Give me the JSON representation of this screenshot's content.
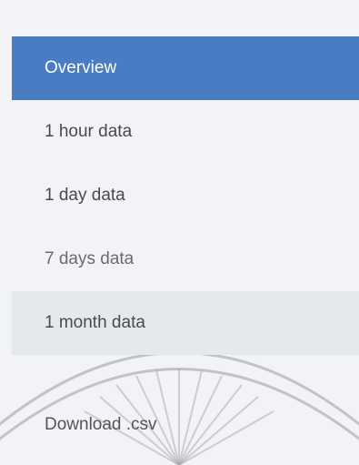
{
  "sidebar": {
    "items": [
      {
        "label": "Overview"
      },
      {
        "label": "1 hour data"
      },
      {
        "label": "1 day data"
      },
      {
        "label": "7 days data"
      },
      {
        "label": "1 month data"
      }
    ],
    "download_label": "Download .csv"
  },
  "colors": {
    "accent": "#4a7cc4",
    "background": "#f1f3f6",
    "hover_row": "#e5e8ec",
    "text": "#4a4a4a"
  }
}
